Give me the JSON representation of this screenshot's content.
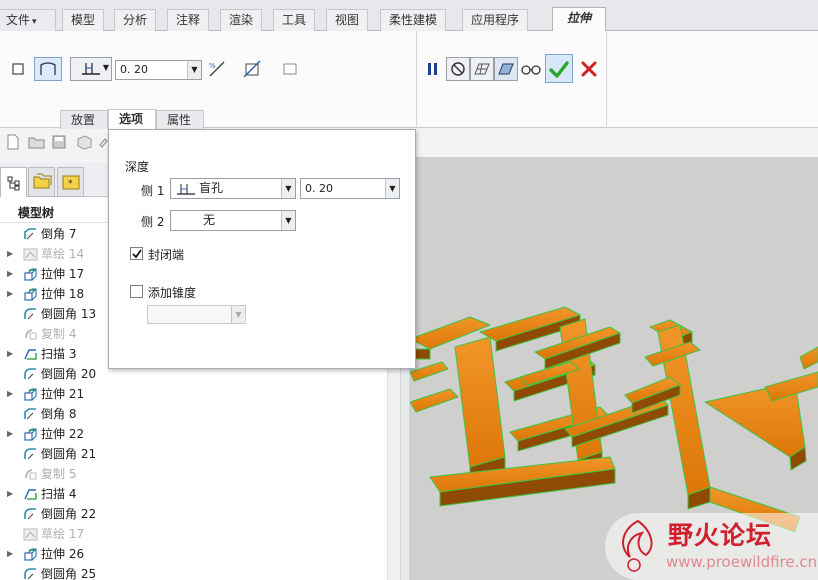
{
  "ribbon_tabs": [
    "文件",
    "模型",
    "分析",
    "注释",
    "渲染",
    "工具",
    "视图",
    "柔性建模",
    "应用程序",
    "拉伸"
  ],
  "file_arrow": "▾",
  "ribbon": {
    "depth_value": "0. 20",
    "sub_tabs": [
      "放置",
      "选项",
      "属性"
    ]
  },
  "options_panel": {
    "depth_label": "深度",
    "side1_label": "侧 1",
    "side1_type": "盲孔",
    "side1_value": "0. 20",
    "side2_label": "侧 2",
    "side2_type": "无",
    "capped_label": "封闭端",
    "capped_checked": true,
    "taper_label": "添加锥度",
    "taper_checked": false
  },
  "model_tree": {
    "header": "模型树",
    "items": [
      {
        "label": "倒角 7",
        "icon": "chamfer-icon",
        "expand": false,
        "dim": false
      },
      {
        "label": "草绘 14",
        "icon": "sketch-icon",
        "expand": true,
        "dim": true
      },
      {
        "label": "拉伸 17",
        "icon": "extrude-icon",
        "expand": true,
        "dim": false
      },
      {
        "label": "拉伸 18",
        "icon": "extrude-icon",
        "expand": true,
        "dim": false
      },
      {
        "label": "倒圆角 13",
        "icon": "round-icon",
        "expand": false,
        "dim": false
      },
      {
        "label": "复制 4",
        "icon": "copy-icon",
        "expand": false,
        "dim": true
      },
      {
        "label": "扫描 3",
        "icon": "sweep-icon",
        "expand": true,
        "dim": false
      },
      {
        "label": "倒圆角 20",
        "icon": "round-icon",
        "expand": false,
        "dim": false
      },
      {
        "label": "拉伸 21",
        "icon": "extrude-icon",
        "expand": true,
        "dim": false
      },
      {
        "label": "倒角 8",
        "icon": "chamfer-icon",
        "expand": false,
        "dim": false
      },
      {
        "label": "拉伸 22",
        "icon": "extrude-icon",
        "expand": true,
        "dim": false
      },
      {
        "label": "倒圆角 21",
        "icon": "round-icon",
        "expand": false,
        "dim": false
      },
      {
        "label": "复制 5",
        "icon": "copy-icon",
        "expand": false,
        "dim": true
      },
      {
        "label": "扫描 4",
        "icon": "sweep-icon",
        "expand": true,
        "dim": false
      },
      {
        "label": "倒圆角 22",
        "icon": "round-icon",
        "expand": false,
        "dim": false
      },
      {
        "label": "草绘 17",
        "icon": "sketch-icon",
        "expand": false,
        "dim": true
      },
      {
        "label": "拉伸 26",
        "icon": "extrude-icon",
        "expand": true,
        "dim": false
      },
      {
        "label": "倒圆角 25",
        "icon": "round-icon",
        "expand": false,
        "dim": false
      }
    ]
  },
  "watermark": {
    "title": "野火论坛",
    "url": "www.proewildfire.cn"
  },
  "colors": {
    "model_orange": "#e8830a",
    "model_dark": "#9a4f05",
    "edge_green": "#39c03a",
    "ok_green": "#2aa52a",
    "cancel_red": "#d42020"
  }
}
